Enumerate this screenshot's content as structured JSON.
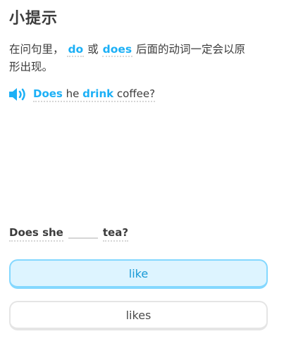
{
  "hint": {
    "title": "小提示",
    "tip_prefix": "在问句里，",
    "keyword_do": "do",
    "connector": "或",
    "keyword_does": "does",
    "tip_suffix_line1": "后面的动词一定会以原",
    "tip_suffix_line2": "形出现。"
  },
  "example": {
    "speaker_icon": "speaker-icon",
    "word_does": "Does",
    "word_he": "he",
    "word_drink": "drink",
    "word_coffee": "coffee?"
  },
  "question": {
    "part1": "Does she",
    "part2": "tea?"
  },
  "options": {
    "like": "like",
    "likes": "likes"
  },
  "colors": {
    "accent_blue": "#1cb0f6",
    "selected_bg": "#ddf4ff",
    "selected_border": "#84d8ff"
  }
}
